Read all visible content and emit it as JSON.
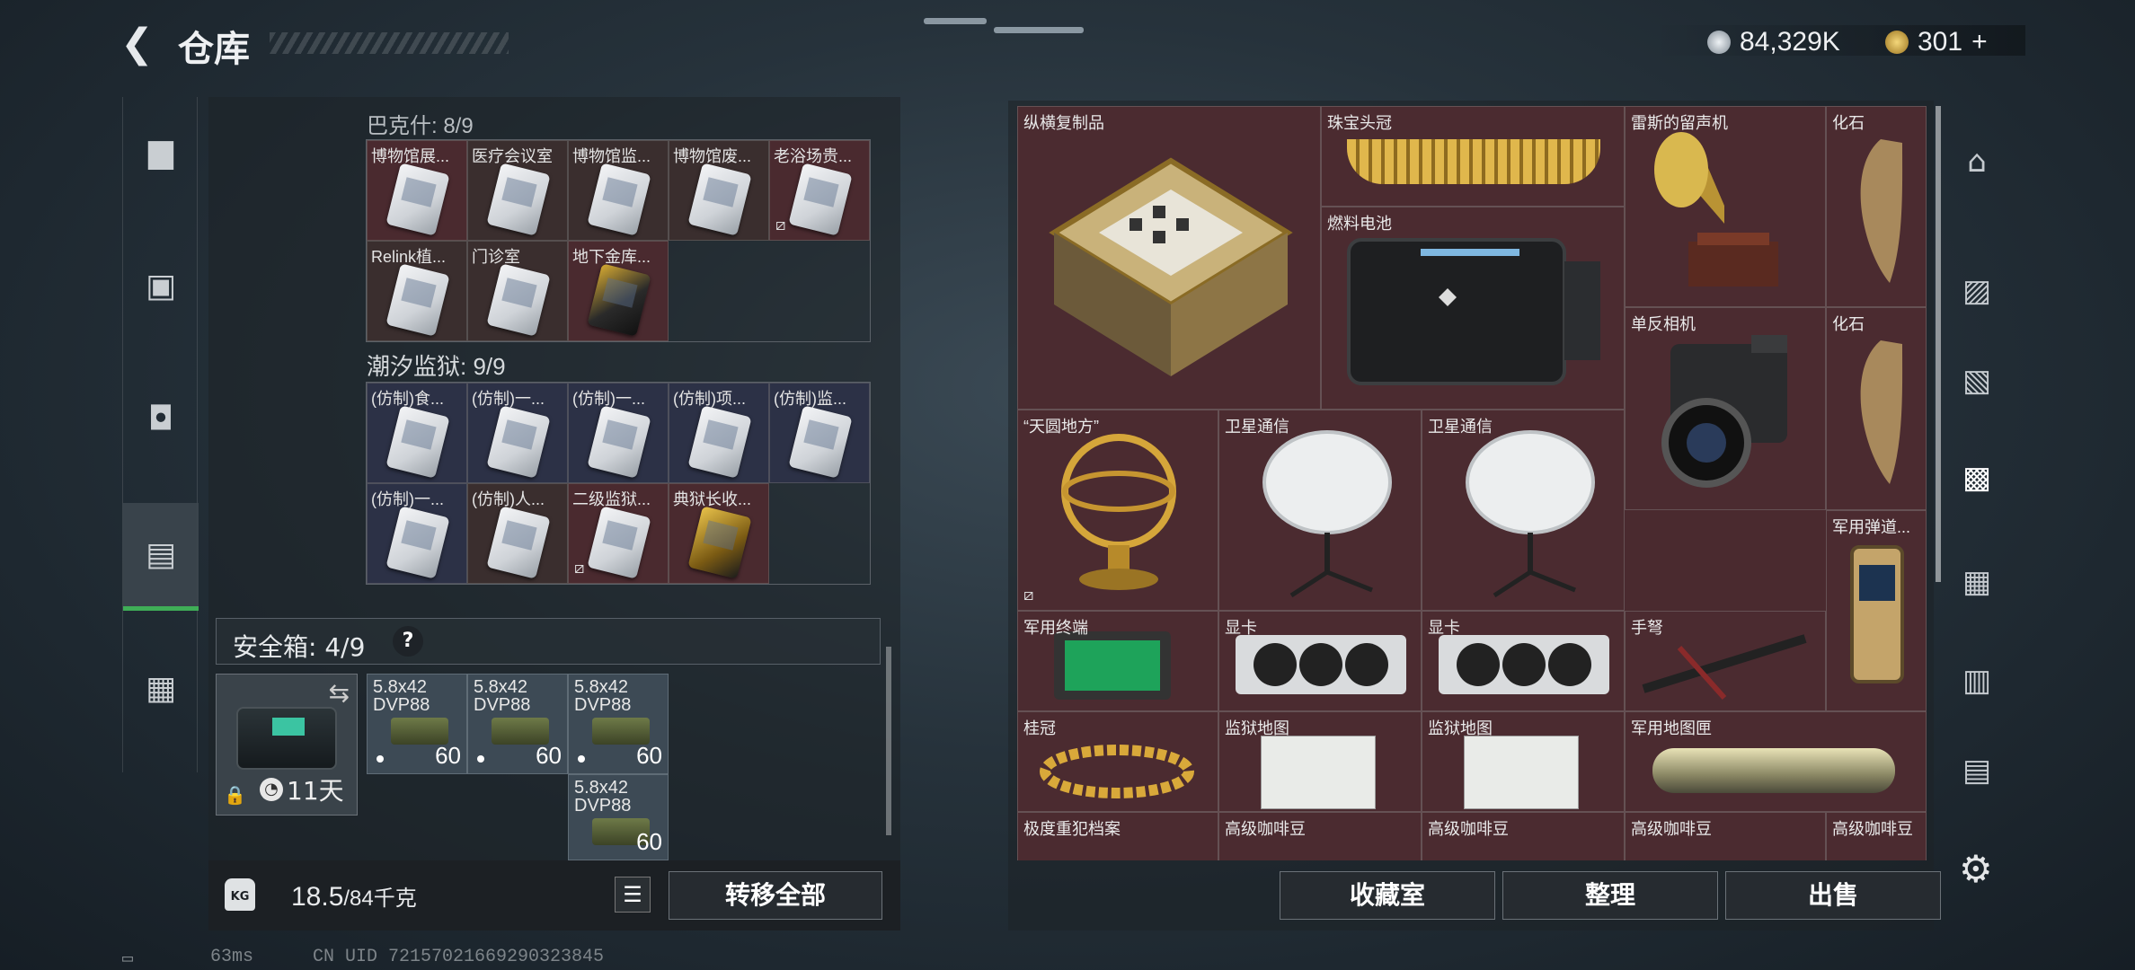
{
  "header": {
    "title": "仓库",
    "currency1": {
      "value": "84,329K",
      "color": "#b8c0c8",
      "icon": "coin-icon"
    },
    "currency2": {
      "value": "301",
      "color": "#d8b04a",
      "icon": "bond-icon"
    },
    "add_label": "+"
  },
  "left_rail": [
    "weapon-icon",
    "armor-icon",
    "backpack-icon",
    "container-icon",
    "case-icon"
  ],
  "sections": {
    "bakeshi": {
      "title": "巴克什: 8/9",
      "items": [
        "博物馆展...",
        "医疗会议室",
        "博物馆监...",
        "博物馆废...",
        "老浴场贵...",
        "Relink植...",
        "门诊室",
        "地下金库..."
      ]
    },
    "chaoxi": {
      "title": "潮汐监狱: 9/9",
      "items": [
        "(仿制)食...",
        "(仿制)一...",
        "(仿制)一...",
        "(仿制)项...",
        "(仿制)监...",
        "(仿制)一...",
        "(仿制)人...",
        "二级监狱...",
        "典狱长收..."
      ]
    }
  },
  "safebox": {
    "label": "安全箱: 4/9",
    "help": "?",
    "timer": "11天",
    "ammo_name": "5.8x42\nDVP88",
    "ammo_count": "60"
  },
  "footer": {
    "weight": "18.5",
    "weight_max": "/84千克",
    "kg_icon": "KG",
    "transfer_all": "转移全部",
    "collection_room": "收藏室",
    "organize": "整理",
    "sell": "出售"
  },
  "stash_items": [
    "纵横复制品",
    "珠宝头冠",
    "雷斯的留声机",
    "化石",
    "燃料电池",
    "化石",
    "“天圆地方”",
    "卫星通信",
    "卫星通信",
    "单反相机",
    "军用弹道...",
    "军用终端",
    "显卡",
    "显卡",
    "手弩",
    "桂冠",
    "监狱地图",
    "监狱地图",
    "军用地图匣",
    "极度重犯档案",
    "高级咖啡豆",
    "高级咖啡豆",
    "高级咖啡豆",
    "高级咖啡豆"
  ],
  "status": {
    "ping": "63ms",
    "uid": "CN UID 72157021669290323845"
  }
}
